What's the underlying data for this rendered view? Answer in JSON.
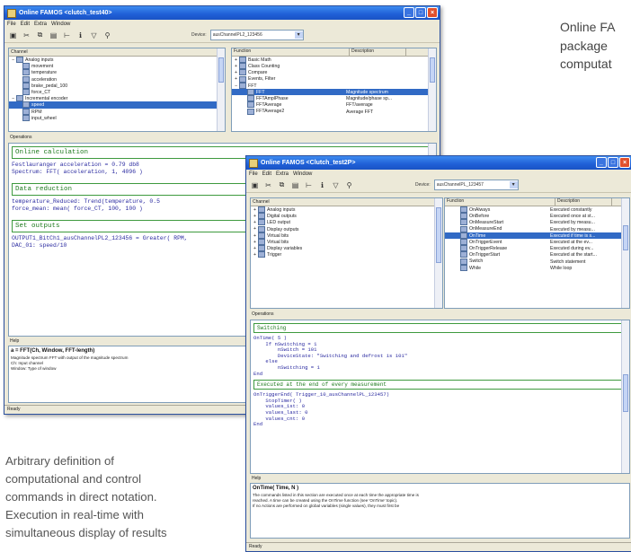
{
  "captions": {
    "top_right_lines": [
      "Online FA",
      "package",
      "computat"
    ],
    "bottom_left_lines": [
      "Arbitrary definition of",
      "computational and control",
      "commands in direct notation.",
      "Execution in real-time with",
      "simultaneous display of results"
    ]
  },
  "window1": {
    "title": "Online FAMOS <clutch_test40>",
    "menu": [
      "File",
      "Edit",
      "Extra",
      "Window"
    ],
    "toolbar_icons": [
      "save-icon",
      "cut-icon",
      "copy-icon",
      "paste-icon",
      "run-icon",
      "info-icon",
      "filter-icon",
      "pin-icon"
    ],
    "device_label": "Device:",
    "device_value": "ausChannelPL2_123456",
    "channel_header": "Channel",
    "channels": [
      {
        "label": "Analog inputs",
        "indent": 0,
        "expander": "−"
      },
      {
        "label": "movement",
        "indent": 1
      },
      {
        "label": "temperature",
        "indent": 1
      },
      {
        "label": "acceleration",
        "indent": 1
      },
      {
        "label": "brake_pedal_100",
        "indent": 1
      },
      {
        "label": "force_CT",
        "indent": 1
      },
      {
        "label": "Incremental encoder",
        "indent": 0,
        "expander": "−"
      },
      {
        "label": "speed",
        "indent": 1,
        "selected": true
      },
      {
        "label": "RPM",
        "indent": 1
      },
      {
        "label": "input_wheel",
        "indent": 1
      }
    ],
    "function_header": "Function",
    "description_header": "Description",
    "functions": [
      {
        "label": "Basic Math",
        "expander": "+",
        "desc": ""
      },
      {
        "label": "Class Counting",
        "expander": "+",
        "desc": ""
      },
      {
        "label": "Compare",
        "expander": "+",
        "desc": ""
      },
      {
        "label": "Events, Filter",
        "expander": "+",
        "desc": ""
      },
      {
        "label": "FFT",
        "expander": "−",
        "desc": ""
      },
      {
        "label": "FFT",
        "expander": "",
        "desc": "Magnitude spectrum",
        "selected": true
      },
      {
        "label": "FFTAmplPhase",
        "expander": "",
        "desc": "Magnitude/phase sp..."
      },
      {
        "label": "FFTAverage",
        "expander": "",
        "desc": "FFT/average"
      },
      {
        "label": "FFTAverage2",
        "expander": "",
        "desc": "Average FFT"
      }
    ],
    "operations_label": "Operations",
    "code_blocks": [
      {
        "type": "box",
        "text": "Online calculation"
      },
      {
        "type": "line",
        "text": "Festlauranger acceleration = 0.79 db8"
      },
      {
        "type": "line",
        "text": "Spectrum: FFT( acceleration, 1, 4096 )"
      },
      {
        "type": "box",
        "text": "Data reduction"
      },
      {
        "type": "line",
        "text": "temperature_Reduced: Trend(temperature, 0.5"
      },
      {
        "type": "line",
        "text": "force_mean: mean( force_CT, 100, 100 )"
      },
      {
        "type": "box",
        "text": "Set outputs"
      },
      {
        "type": "line",
        "text": "OUTPUT1_BitCh1_ausChannelPL2_123456 = Greater( RPM,"
      },
      {
        "type": "line",
        "text": "DAC_01: speed/10"
      }
    ],
    "help_label": "Help",
    "help_title": "a = FFT(Ch, Window, FFT-length)",
    "help_lines": [
      "Magnitude spectrum FFT with output of the magnitude spectrum",
      "Ch: Input channel",
      "Window: Type of window"
    ],
    "status": "Ready"
  },
  "window2": {
    "title": "Online FAMOS <Clutch_test2P>",
    "menu": [
      "File",
      "Edit",
      "Extra",
      "Window"
    ],
    "toolbar_icons": [
      "save-icon",
      "cut-icon",
      "copy-icon",
      "paste-icon",
      "run-icon",
      "info-icon",
      "filter-icon",
      "pin-icon"
    ],
    "device_label": "Device:",
    "device_value": "ausChannelPL_123457",
    "channel_header": "Channel",
    "channels": [
      {
        "label": "Analog inputs",
        "expander": "+"
      },
      {
        "label": "Digital outputs",
        "expander": "+"
      },
      {
        "label": "LED output",
        "expander": "+"
      },
      {
        "label": "Display outputs",
        "expander": "+"
      },
      {
        "label": "Virtual bits",
        "expander": "+"
      },
      {
        "label": "Virtual bits",
        "expander": "+"
      },
      {
        "label": "Display variables",
        "expander": "+"
      },
      {
        "label": "Trigger",
        "expander": "+"
      }
    ],
    "function_header": "Function",
    "description_header": "Description",
    "functions": [
      {
        "label": "OnAlways",
        "desc": "Executed constantly"
      },
      {
        "label": "OnBefore",
        "desc": "Executed once at st..."
      },
      {
        "label": "OnMeasureStart",
        "desc": "Executed by measu..."
      },
      {
        "label": "OnMeasureEnd",
        "desc": "Executed by measu..."
      },
      {
        "label": "OnTime",
        "desc": "Executed if time is s...",
        "selected": true
      },
      {
        "label": "OnTriggerEvent",
        "desc": "Executed at the ev..."
      },
      {
        "label": "OnTriggerRelease",
        "desc": "Executed during ev..."
      },
      {
        "label": "OnTriggerStart",
        "desc": "Executed at the start..."
      },
      {
        "label": "Switch",
        "desc": "Switch statement"
      },
      {
        "label": "While",
        "desc": "While loop"
      }
    ],
    "operations_label": "Operations",
    "code_lines": [
      {
        "text": "Switching",
        "kind": "box"
      },
      {
        "text": "OnTime( 5 )",
        "kind": "code"
      },
      {
        "text": "    If nSwitching = 1",
        "kind": "code"
      },
      {
        "text": "        nSwitch = 101",
        "kind": "code"
      },
      {
        "text": "        DeviceState: \"Switching and defrost is 101\"",
        "kind": "code"
      },
      {
        "text": "    else",
        "kind": "code"
      },
      {
        "text": "        nSwitching = 1",
        "kind": "code"
      },
      {
        "text": "End",
        "kind": "code"
      },
      {
        "text": "Executed at the end of every measurement",
        "kind": "box"
      },
      {
        "text": "OnTriggerEnd( Trigger_10_ausChannelPL_123457)",
        "kind": "code"
      },
      {
        "text": "    StopTimer( )",
        "kind": "code"
      },
      {
        "text": "    values_1st: 0",
        "kind": "code"
      },
      {
        "text": "    values_last: 0",
        "kind": "code"
      },
      {
        "text": "    values_cnt: 0",
        "kind": "code"
      },
      {
        "text": "End",
        "kind": "code"
      }
    ],
    "help_label": "Help",
    "help_title": "OnTime( Time, N )",
    "help_lines": [
      "The commands listed in this section are executed once at each time the appropriate time is",
      "reached. A time can be created using the OnTime function (see 'OnTime' topic).",
      "If no Actions are performed on global variables (single values), they must first be"
    ],
    "status": "Ready"
  }
}
